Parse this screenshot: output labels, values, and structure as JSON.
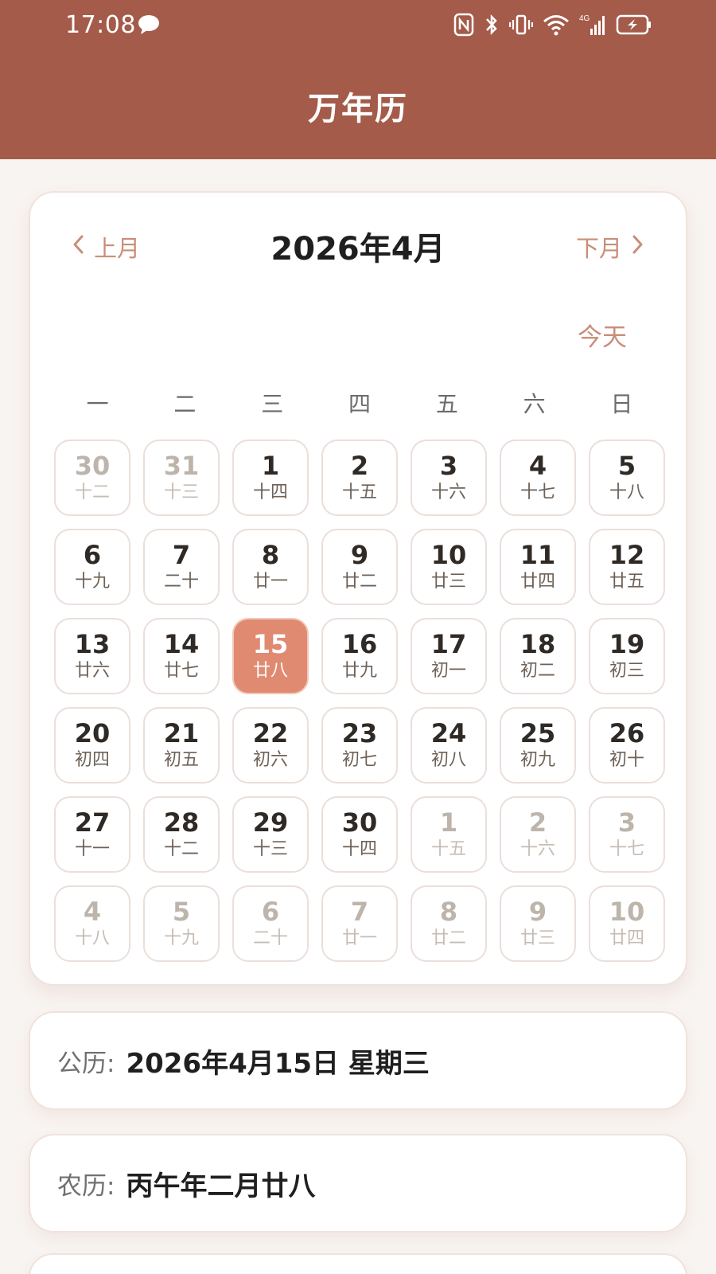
{
  "status_bar": {
    "time": "17:08",
    "network": "4G"
  },
  "header": {
    "title": "万年历"
  },
  "calendar": {
    "prev_label": "上月",
    "next_label": "下月",
    "month_title": "2026年4月",
    "today_label": "今天",
    "weekdays": [
      "一",
      "二",
      "三",
      "四",
      "五",
      "六",
      "日"
    ],
    "days": [
      {
        "d": "30",
        "l": "十二",
        "in_month": false,
        "selected": false
      },
      {
        "d": "31",
        "l": "十三",
        "in_month": false,
        "selected": false
      },
      {
        "d": "1",
        "l": "十四",
        "in_month": true,
        "selected": false
      },
      {
        "d": "2",
        "l": "十五",
        "in_month": true,
        "selected": false
      },
      {
        "d": "3",
        "l": "十六",
        "in_month": true,
        "selected": false
      },
      {
        "d": "4",
        "l": "十七",
        "in_month": true,
        "selected": false
      },
      {
        "d": "5",
        "l": "十八",
        "in_month": true,
        "selected": false
      },
      {
        "d": "6",
        "l": "十九",
        "in_month": true,
        "selected": false
      },
      {
        "d": "7",
        "l": "二十",
        "in_month": true,
        "selected": false
      },
      {
        "d": "8",
        "l": "廿一",
        "in_month": true,
        "selected": false
      },
      {
        "d": "9",
        "l": "廿二",
        "in_month": true,
        "selected": false
      },
      {
        "d": "10",
        "l": "廿三",
        "in_month": true,
        "selected": false
      },
      {
        "d": "11",
        "l": "廿四",
        "in_month": true,
        "selected": false
      },
      {
        "d": "12",
        "l": "廿五",
        "in_month": true,
        "selected": false
      },
      {
        "d": "13",
        "l": "廿六",
        "in_month": true,
        "selected": false
      },
      {
        "d": "14",
        "l": "廿七",
        "in_month": true,
        "selected": false
      },
      {
        "d": "15",
        "l": "廿八",
        "in_month": true,
        "selected": true
      },
      {
        "d": "16",
        "l": "廿九",
        "in_month": true,
        "selected": false
      },
      {
        "d": "17",
        "l": "初一",
        "in_month": true,
        "selected": false
      },
      {
        "d": "18",
        "l": "初二",
        "in_month": true,
        "selected": false
      },
      {
        "d": "19",
        "l": "初三",
        "in_month": true,
        "selected": false
      },
      {
        "d": "20",
        "l": "初四",
        "in_month": true,
        "selected": false
      },
      {
        "d": "21",
        "l": "初五",
        "in_month": true,
        "selected": false
      },
      {
        "d": "22",
        "l": "初六",
        "in_month": true,
        "selected": false
      },
      {
        "d": "23",
        "l": "初七",
        "in_month": true,
        "selected": false
      },
      {
        "d": "24",
        "l": "初八",
        "in_month": true,
        "selected": false
      },
      {
        "d": "25",
        "l": "初九",
        "in_month": true,
        "selected": false
      },
      {
        "d": "26",
        "l": "初十",
        "in_month": true,
        "selected": false
      },
      {
        "d": "27",
        "l": "十一",
        "in_month": true,
        "selected": false
      },
      {
        "d": "28",
        "l": "十二",
        "in_month": true,
        "selected": false
      },
      {
        "d": "29",
        "l": "十三",
        "in_month": true,
        "selected": false
      },
      {
        "d": "30",
        "l": "十四",
        "in_month": true,
        "selected": false
      },
      {
        "d": "1",
        "l": "十五",
        "in_month": false,
        "selected": false
      },
      {
        "d": "2",
        "l": "十六",
        "in_month": false,
        "selected": false
      },
      {
        "d": "3",
        "l": "十七",
        "in_month": false,
        "selected": false
      },
      {
        "d": "4",
        "l": "十八",
        "in_month": false,
        "selected": false
      },
      {
        "d": "5",
        "l": "十九",
        "in_month": false,
        "selected": false
      },
      {
        "d": "6",
        "l": "二十",
        "in_month": false,
        "selected": false
      },
      {
        "d": "7",
        "l": "廿一",
        "in_month": false,
        "selected": false
      },
      {
        "d": "8",
        "l": "廿二",
        "in_month": false,
        "selected": false
      },
      {
        "d": "9",
        "l": "廿三",
        "in_month": false,
        "selected": false
      },
      {
        "d": "10",
        "l": "廿四",
        "in_month": false,
        "selected": false
      }
    ]
  },
  "info": {
    "solar_label": "公历:",
    "solar_value": "2026年4月15日 星期三",
    "lunar_label": "农历:",
    "lunar_value": "丙午年二月廿八"
  },
  "colors": {
    "header_bg": "#a45b4a",
    "accent": "#c98e78",
    "selected_day": "#e08a72",
    "page_bg": "#f8f4f1"
  },
  "icons": {
    "status": [
      "message-icon",
      "nfc-icon",
      "bluetooth-icon",
      "vibrate-icon",
      "wifi-icon",
      "signal-icon",
      "battery-charging-icon"
    ],
    "nav": [
      "chevron-left-icon",
      "chevron-right-icon"
    ]
  }
}
